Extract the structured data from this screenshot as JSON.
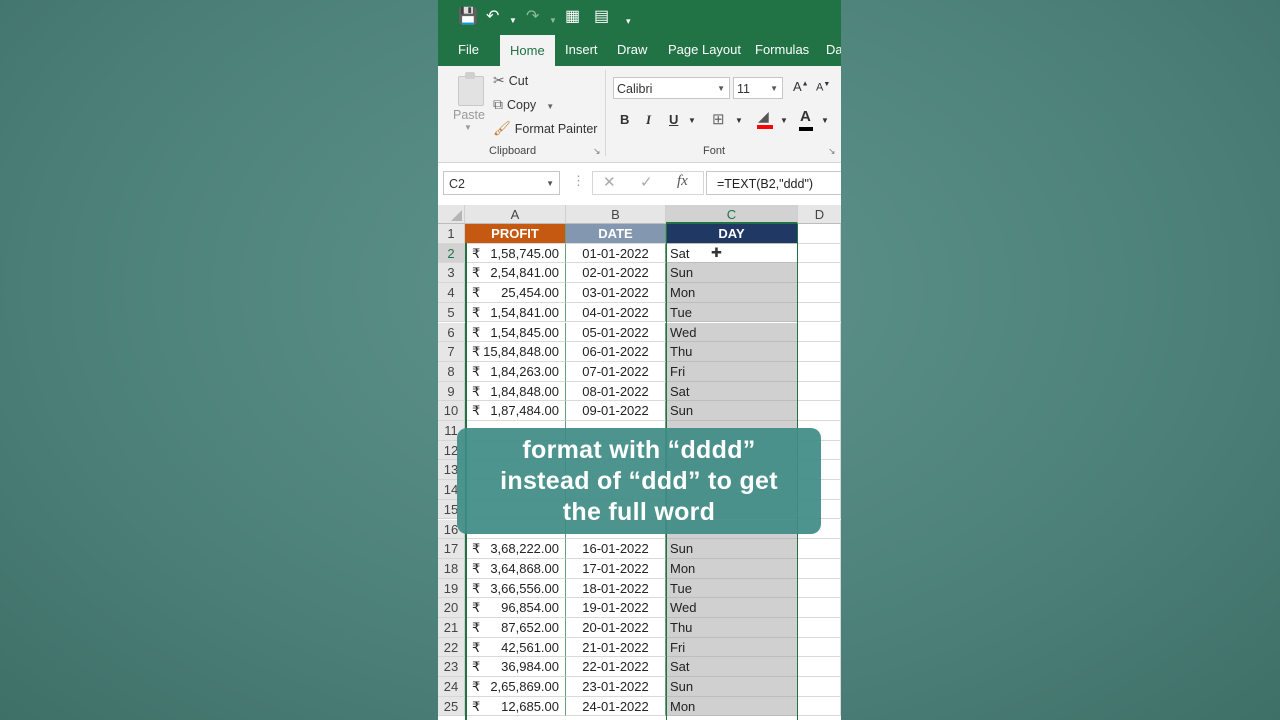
{
  "tabs": [
    "File",
    "Home",
    "Insert",
    "Draw",
    "Page Layout",
    "Formulas",
    "Da"
  ],
  "active_tab": "Home",
  "clipboard": {
    "paste": "Paste",
    "cut": "Cut",
    "copy": "Copy",
    "format_painter": "Format Painter",
    "group_label": "Clipboard"
  },
  "font": {
    "family": "Calibri",
    "size": "11",
    "grow": "A",
    "shrink": "A",
    "bold": "B",
    "italic": "I",
    "underline": "U",
    "font_color": "A",
    "group_label": "Font"
  },
  "formula_bar": {
    "name_box": "C2",
    "fx": "fx",
    "formula": "=TEXT(B2,\"ddd\")"
  },
  "columns": [
    "A",
    "B",
    "C",
    "D"
  ],
  "selected_column": "C",
  "headers": {
    "profit": "PROFIT",
    "date": "DATE",
    "day": "DAY"
  },
  "currency": "₹",
  "rows": [
    {
      "n": "2",
      "profit": "1,58,745.00",
      "date": "01-01-2022",
      "day": "Sat"
    },
    {
      "n": "3",
      "profit": "2,54,841.00",
      "date": "02-01-2022",
      "day": "Sun"
    },
    {
      "n": "4",
      "profit": "25,454.00",
      "date": "03-01-2022",
      "day": "Mon"
    },
    {
      "n": "5",
      "profit": "1,54,841.00",
      "date": "04-01-2022",
      "day": "Tue"
    },
    {
      "n": "6",
      "profit": "1,54,845.00",
      "date": "05-01-2022",
      "day": "Wed"
    },
    {
      "n": "7",
      "profit": "15,84,848.00",
      "date": "06-01-2022",
      "day": "Thu"
    },
    {
      "n": "8",
      "profit": "1,84,263.00",
      "date": "07-01-2022",
      "day": "Fri"
    },
    {
      "n": "9",
      "profit": "1,84,848.00",
      "date": "08-01-2022",
      "day": "Sat"
    },
    {
      "n": "10",
      "profit": "1,87,484.00",
      "date": "09-01-2022",
      "day": "Sun"
    },
    {
      "n": "11",
      "profit": "",
      "date": "",
      "day": ""
    },
    {
      "n": "12",
      "profit": "",
      "date": "",
      "day": ""
    },
    {
      "n": "13",
      "profit": "",
      "date": "",
      "day": ""
    },
    {
      "n": "14",
      "profit": "",
      "date": "",
      "day": ""
    },
    {
      "n": "15",
      "profit": "",
      "date": "",
      "day": ""
    },
    {
      "n": "16",
      "profit": "",
      "date": "",
      "day": ""
    },
    {
      "n": "17",
      "profit": "3,68,222.00",
      "date": "16-01-2022",
      "day": "Sun"
    },
    {
      "n": "18",
      "profit": "3,64,868.00",
      "date": "17-01-2022",
      "day": "Mon"
    },
    {
      "n": "19",
      "profit": "3,66,556.00",
      "date": "18-01-2022",
      "day": "Tue"
    },
    {
      "n": "20",
      "profit": "96,854.00",
      "date": "19-01-2022",
      "day": "Wed"
    },
    {
      "n": "21",
      "profit": "87,652.00",
      "date": "20-01-2022",
      "day": "Thu"
    },
    {
      "n": "22",
      "profit": "42,561.00",
      "date": "21-01-2022",
      "day": "Fri"
    },
    {
      "n": "23",
      "profit": "36,984.00",
      "date": "22-01-2022",
      "day": "Sat"
    },
    {
      "n": "24",
      "profit": "2,65,869.00",
      "date": "23-01-2022",
      "day": "Sun"
    },
    {
      "n": "25",
      "profit": "12,685.00",
      "date": "24-01-2022",
      "day": "Mon"
    }
  ],
  "caption": [
    "format with “dddd”",
    "instead of “ddd” to get",
    "the full word"
  ],
  "colors": {
    "excel_green": "#217346",
    "profit_header": "#c65911",
    "date_header": "#8497b0",
    "day_header": "#1f3864",
    "caption_bg": "#3e8c84"
  }
}
